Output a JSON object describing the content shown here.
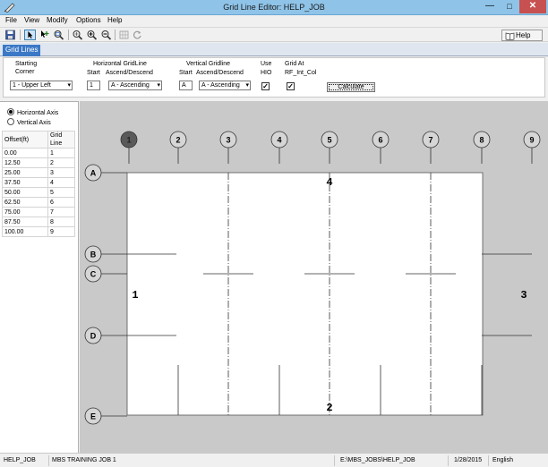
{
  "window": {
    "title": "Grid Line Editor: HELP_JOB",
    "minimize": "—",
    "maximize": "□",
    "close": "✕"
  },
  "menu": [
    "File",
    "View",
    "Modify",
    "Options",
    "Help"
  ],
  "toolbar": {
    "icons": [
      "save-icon",
      "pointer-icon",
      "add-gridline-icon",
      "zoom-window-icon",
      "zoom-extents-icon",
      "zoom-in-icon",
      "zoom-out-icon",
      "grid-select-icon",
      "refresh-icon"
    ],
    "help_label": "Help"
  },
  "tabs": [
    "Grid Lines"
  ],
  "form": {
    "starting_corner_label_1": "Starting",
    "starting_corner_label_2": "Corner",
    "starting_corner_value": "1 - Upper Left",
    "horizontal_label": "Horizontal GridLine",
    "horizontal_start_label": "Start",
    "horizontal_order_label": "Ascend/Descend",
    "horizontal_start_value": "1",
    "horizontal_order_value": "A - Ascending",
    "vertical_label": "Vertical Gridline",
    "vertical_start_label": "Start",
    "vertical_order_label": "Ascend/Descend",
    "vertical_start_value": "A",
    "vertical_order_value": "A - Ascending",
    "use_label_1": "Use",
    "use_label_2": "HIO",
    "use_hio_checked": true,
    "grid_at_label_1": "Grid At",
    "grid_at_label_2": "RF_Int_Col",
    "grid_at_checked": true,
    "calculate_label": "Calculate"
  },
  "axis_options": {
    "horizontal": "Horizontal Axis",
    "vertical": "Vertical Axis",
    "selected": "horizontal"
  },
  "grid_table": {
    "headers": [
      "Offset(ft)",
      "Grid Line"
    ],
    "rows": [
      [
        "0.00",
        "1"
      ],
      [
        "12.50",
        "2"
      ],
      [
        "25.00",
        "3"
      ],
      [
        "37.50",
        "4"
      ],
      [
        "50.00",
        "5"
      ],
      [
        "62.50",
        "6"
      ],
      [
        "75.00",
        "7"
      ],
      [
        "87.50",
        "8"
      ],
      [
        "100.00",
        "9"
      ]
    ]
  },
  "canvas": {
    "column_bubbles": [
      "1",
      "2",
      "3",
      "4",
      "5",
      "6",
      "7",
      "8",
      "9"
    ],
    "row_bubbles": [
      "A",
      "B",
      "C",
      "D",
      "E"
    ],
    "wall_numbers": {
      "top": "4",
      "bottom": "2",
      "left": "1",
      "right": "3"
    },
    "colors": {
      "background": "#c9c9c9",
      "building": "#ffffff",
      "selected_bubble": "#5a5a5a"
    }
  },
  "status": {
    "job": "HELP_JOB",
    "job_name": "MBS TRAINING JOB 1",
    "path": "E:\\MBS_JOBS\\HELP_JOB",
    "date": "1/28/2015",
    "language": "English"
  }
}
